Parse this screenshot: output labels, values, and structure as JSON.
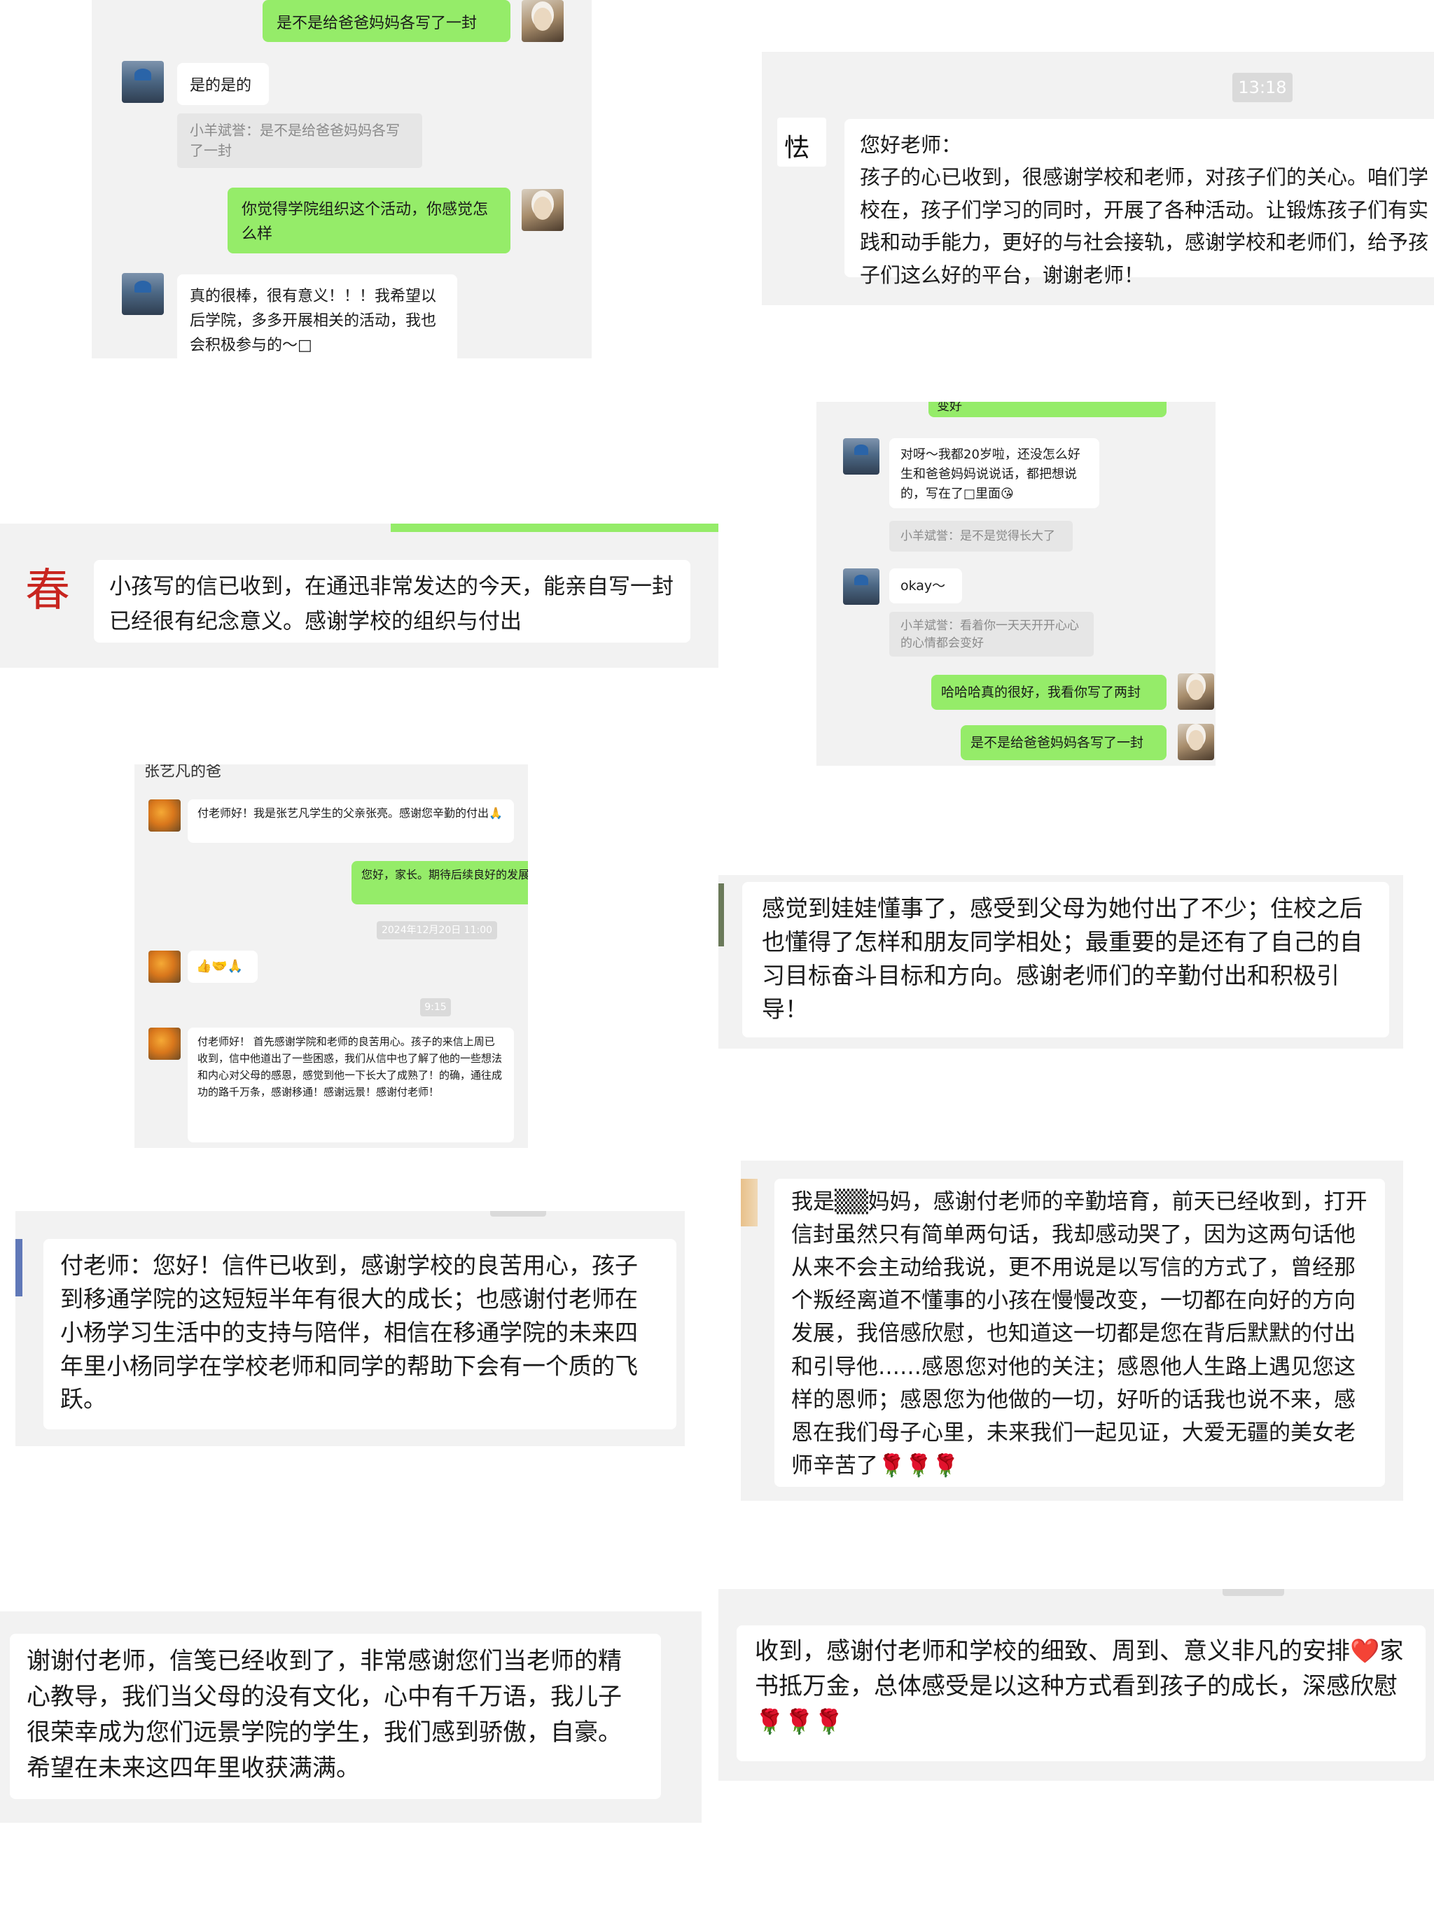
{
  "panel1": {
    "msg1": "是不是给爸爸妈妈各写了一封",
    "msg2": "是的是的",
    "quote1": "小羊斌誉：是不是给爸爸妈妈各写了一封",
    "msg3": "你觉得学院组织这个活动，你感觉怎么样",
    "msg4": "真的很棒，很有意义！！！我希望以后学院，多多开展相关的活动，我也会积极参与的～□"
  },
  "panel2": {
    "time": "13:18",
    "msg": "您好老师：\n孩子的心已收到，很感谢学校和老师，对孩子们的关心。咱们学校在，孩子们学习的同时，开展了各种活动。让锻炼孩子们有实践和动手能力，更好的与社会接轨，感谢学校和老师们，给予孩子们这么好的平台，谢谢老师！"
  },
  "panel3": {
    "top_cut": "变好",
    "msg1": "对呀～我都20岁啦，还没怎么好生和爸爸妈妈说说话，都把想说的，写在了□里面😘",
    "quote1": "小羊斌誉：是不是觉得长大了",
    "msg2": "okay～□",
    "quote2": "小羊斌誉：看着你一天天开开心心的心情都会变好",
    "msg3": "哈哈哈真的很好，我看你写了两封",
    "msg4": "是不是给爸爸妈妈各写了一封"
  },
  "panel4": {
    "msg": "小孩写的信已收到，在通迅非常发达的今天，能亲自写一封已经很有纪念意义。感谢学校的组织与付出"
  },
  "panel5": {
    "title": "张艺凡的爸",
    "msg1": "付老师好！我是张艺凡学生的父亲张亮。感谢您辛勤的付出🙏",
    "msg2": "您好，家长。期待后续良好的发展。❤️",
    "time1": "2024年12月20日 11:00",
    "msg3": "👍🤝🙏",
    "time2": "9:15",
    "msg4": "付老师好！ 首先感谢学院和老师的良苦用心。孩子的来信上周已收到，信中他道出了一些困惑，我们从信中也了解了他的一些想法和内心对父母的感恩，感觉到他一下长大了成熟了！的确，通往成功的路千万条，感谢移通！感谢远景！感谢付老师！"
  },
  "panel6": {
    "msg": "感觉到娃娃懂事了，感受到父母为她付出了不少；住校之后也懂得了怎样和朋友同学相处；最重要的是还有了自己的自习目标奋斗目标和方向。感谢老师们的辛勤付出和积极引导！"
  },
  "panel7": {
    "msg": "付老师：您好！信件已收到，感谢学校的良苦用心，孩子到移通学院的这短短半年有很大的成长；也感谢付老师在小杨学习生活中的支持与陪伴，相信在移通学院的未来四年里小杨同学在学校老师和同学的帮助下会有一个质的飞跃。"
  },
  "panel8": {
    "msg": "我是▒▒妈妈，感谢付老师的辛勤培育，前天已经收到，打开信封虽然只有简单两句话，我却感动哭了，因为这两句话他从来不会主动给我说，更不用说是以写信的方式了，曾经那个叛经离道不懂事的小孩在慢慢改变，一切都在向好的方向发展，我倍感欣慰，也知道这一切都是您在背后默默的付出和引导他……感恩您对他的关注；感恩他人生路上遇见您这样的恩师；感恩您为他做的一切，好听的话我也说不来，感恩在我们母子心里，未来我们一起见证，大爱无疆的美女老师辛苦了🌹🌹🌹"
  },
  "panel9": {
    "msg": "谢谢付老师，信笺已经收到了，非常感谢您们当老师的精心教导，我们当父母的没有文化，心中有千万语，我儿子很荣幸成为您们远景学院的学生，我们感到骄傲，自豪。希望在未来这四年里收获满满。"
  },
  "panel10": {
    "msg": "收到，感谢付老师和学校的细致、周到、意义非凡的安排❤️家书抵万金，总体感受是以这种方式看到孩子的成长，深感欣慰🌹🌹🌹"
  },
  "colors": {
    "green_bubble": "#95ec69",
    "panel_bg": "#f2f2f2"
  }
}
